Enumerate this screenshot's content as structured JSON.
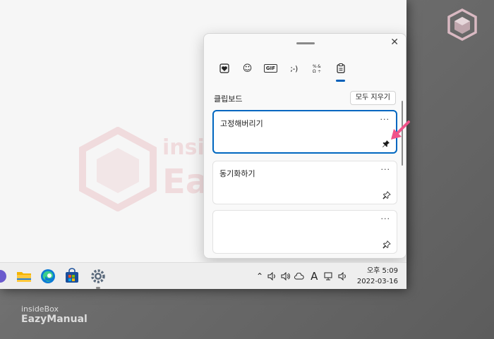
{
  "clipboard_panel": {
    "tabs": [
      {
        "name": "recent",
        "icon": "heart-sticker-icon"
      },
      {
        "name": "emoji",
        "icon": "smiley-icon",
        "glyph": "☺"
      },
      {
        "name": "gif",
        "icon": "gif-icon",
        "glyph": "GIF"
      },
      {
        "name": "kaomoji",
        "icon": "kaomoji-icon",
        "glyph": ";-)"
      },
      {
        "name": "symbols",
        "icon": "symbols-icon"
      },
      {
        "name": "clipboard",
        "icon": "clipboard-icon",
        "active": true
      }
    ],
    "title": "클립보드",
    "clear_all_label": "모두 지우기",
    "more_glyph": "···",
    "close_glyph": "✕",
    "items": [
      {
        "text": "고정해버리기",
        "pinned": true,
        "selected": true
      },
      {
        "text": "동기화하기",
        "pinned": false,
        "selected": false
      },
      {
        "text": "",
        "pinned": false,
        "selected": false
      }
    ]
  },
  "taskbar": {
    "tray_language": "A",
    "clock": {
      "time": "오후 5:09",
      "date": "2022-03-16"
    }
  },
  "watermark": {
    "line1": "insideBox",
    "line2": "EazyManual"
  },
  "colors": {
    "accent": "#0067c0",
    "arrow": "#f0538a"
  }
}
